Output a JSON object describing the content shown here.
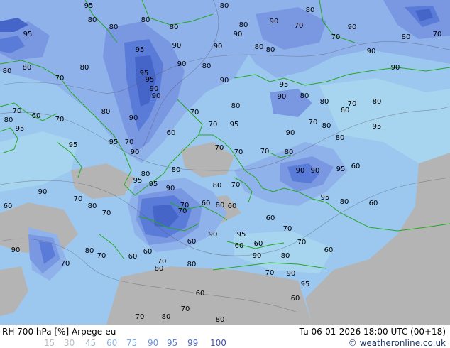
{
  "footer": {
    "title": "RH 700 hPa [%] Arpege-eu",
    "timestamp": "Tu 06-01-2026 18:00 UTC (00+18)",
    "credit": "© weatheronline.co.uk"
  },
  "legend": [
    {
      "label": "15",
      "color": "#b9bcc2"
    },
    {
      "label": "30",
      "color": "#b5bdc6"
    },
    {
      "label": "45",
      "color": "#aab7c6"
    },
    {
      "label": "60",
      "color": "#8fb4e6"
    },
    {
      "label": "75",
      "color": "#7aa9e8"
    },
    {
      "label": "90",
      "color": "#6a96de"
    },
    {
      "label": "95",
      "color": "#5a7fd4"
    },
    {
      "label": "99",
      "color": "#4b67c5"
    },
    {
      "label": "100",
      "color": "#3f52b5"
    }
  ],
  "colors": {
    "dry": "#b4b4b4",
    "rh60": "#a7d4ee",
    "rh70": "#9cc8ef",
    "rh80": "#8fb2ea",
    "rh90": "#7a97e2",
    "rh95": "#5a7cd8",
    "rh99": "#4665c9",
    "coast": "#22aa22"
  },
  "isolines": [
    {
      "label": "95"
    },
    {
      "label": "80"
    },
    {
      "label": "80"
    },
    {
      "label": "80"
    },
    {
      "label": "80"
    },
    {
      "label": "90"
    },
    {
      "label": "80"
    },
    {
      "label": "80"
    },
    {
      "label": "80"
    },
    {
      "label": "70"
    },
    {
      "label": "70"
    },
    {
      "label": "95"
    },
    {
      "label": "90"
    },
    {
      "label": "90"
    },
    {
      "label": "70"
    },
    {
      "label": "80"
    },
    {
      "label": "80"
    },
    {
      "label": "95"
    },
    {
      "label": "90"
    },
    {
      "label": "90"
    },
    {
      "label": "80"
    },
    {
      "label": "90"
    },
    {
      "label": "95"
    },
    {
      "label": "90"
    },
    {
      "label": "80"
    },
    {
      "label": "80"
    },
    {
      "label": "80"
    },
    {
      "label": "80"
    },
    {
      "label": "90"
    },
    {
      "label": "90"
    },
    {
      "label": "95"
    },
    {
      "label": "70"
    },
    {
      "label": "95"
    },
    {
      "label": "90"
    },
    {
      "label": "80"
    },
    {
      "label": "90"
    },
    {
      "label": "80"
    },
    {
      "label": "90"
    },
    {
      "label": "80"
    },
    {
      "label": "80"
    },
    {
      "label": "70"
    },
    {
      "label": "70"
    },
    {
      "label": "80"
    },
    {
      "label": "70"
    },
    {
      "label": "60"
    },
    {
      "label": "80"
    },
    {
      "label": "90"
    },
    {
      "label": "70"
    },
    {
      "label": "60"
    },
    {
      "label": "80"
    },
    {
      "label": "70"
    },
    {
      "label": "95"
    },
    {
      "label": "90"
    },
    {
      "label": "95"
    },
    {
      "label": "60"
    },
    {
      "label": "80"
    },
    {
      "label": "95"
    },
    {
      "label": "90"
    },
    {
      "label": "70"
    },
    {
      "label": "70"
    },
    {
      "label": "70"
    },
    {
      "label": "80"
    },
    {
      "label": "80"
    },
    {
      "label": "90"
    },
    {
      "label": "90"
    },
    {
      "label": "95"
    },
    {
      "label": "95"
    },
    {
      "label": "95"
    },
    {
      "label": "80"
    },
    {
      "label": "70"
    },
    {
      "label": "60"
    },
    {
      "label": "90"
    },
    {
      "label": "95"
    },
    {
      "label": "90"
    },
    {
      "label": "80"
    },
    {
      "label": "60"
    },
    {
      "label": "60"
    },
    {
      "label": "70"
    },
    {
      "label": "60"
    },
    {
      "label": "80"
    },
    {
      "label": "60"
    },
    {
      "label": "70"
    },
    {
      "label": "60"
    },
    {
      "label": "70"
    },
    {
      "label": "60"
    },
    {
      "label": "60"
    },
    {
      "label": "70"
    },
    {
      "label": "60"
    },
    {
      "label": "90"
    },
    {
      "label": "80"
    },
    {
      "label": "70"
    },
    {
      "label": "60"
    },
    {
      "label": "60"
    },
    {
      "label": "70"
    },
    {
      "label": "70"
    },
    {
      "label": "80"
    },
    {
      "label": "60"
    },
    {
      "label": "70"
    },
    {
      "label": "80"
    },
    {
      "label": "70"
    },
    {
      "label": "80"
    },
    {
      "label": "60"
    },
    {
      "label": "70"
    },
    {
      "label": "90"
    },
    {
      "label": "95"
    },
    {
      "label": "80"
    },
    {
      "label": "90"
    },
    {
      "label": "95"
    },
    {
      "label": "90"
    },
    {
      "label": "80"
    },
    {
      "label": "60"
    },
    {
      "label": "70"
    },
    {
      "label": "80"
    },
    {
      "label": "70"
    },
    {
      "label": "70"
    },
    {
      "label": "80"
    },
    {
      "label": "95"
    },
    {
      "label": "70"
    },
    {
      "label": "95"
    }
  ]
}
